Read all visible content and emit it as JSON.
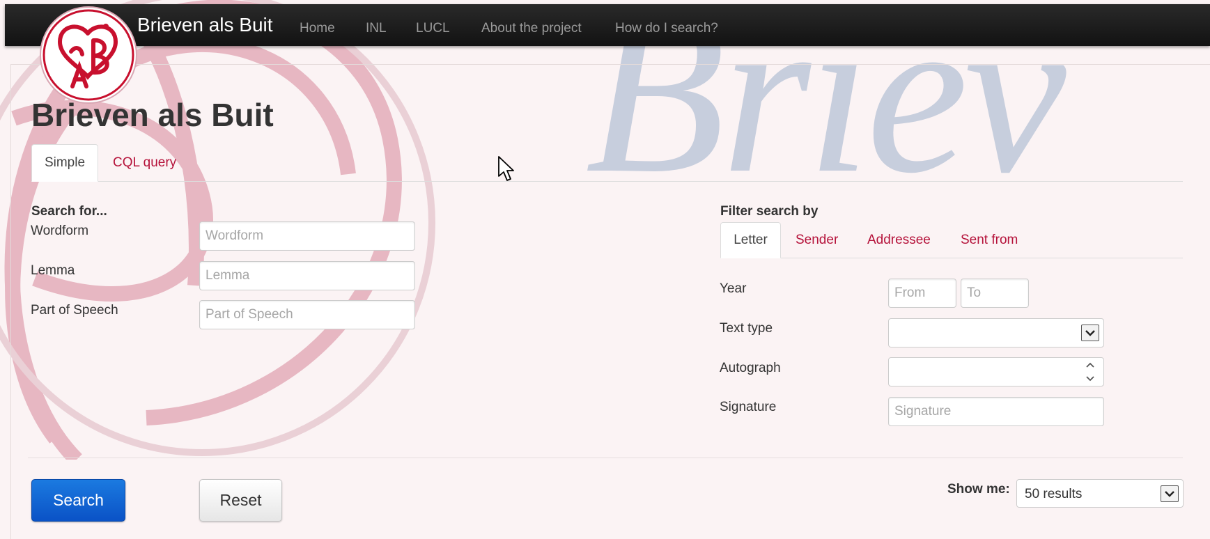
{
  "navbar": {
    "brand": "Brieven als Buit",
    "links": [
      "Home",
      "INL",
      "LUCL",
      "About the project",
      "How do I search?"
    ]
  },
  "watermark_text": "Briev",
  "page_title": "Brieven als Buit",
  "search_tabs": [
    "Simple",
    "CQL query"
  ],
  "search_for": {
    "heading": "Search for...",
    "fields": [
      {
        "label": "Wordform",
        "placeholder": "Wordform",
        "value": ""
      },
      {
        "label": "Lemma",
        "placeholder": "Lemma",
        "value": ""
      },
      {
        "label": "Part of Speech",
        "placeholder": "Part of Speech",
        "value": ""
      }
    ]
  },
  "filter": {
    "heading": "Filter search by",
    "tabs": [
      "Letter",
      "Sender",
      "Addressee",
      "Sent from"
    ],
    "year_label": "Year",
    "year_from_placeholder": "From",
    "year_to_placeholder": "To",
    "text_type_label": "Text type",
    "text_type_value": "",
    "autograph_label": "Autograph",
    "signature_label": "Signature",
    "signature_placeholder": "Signature"
  },
  "actions": {
    "search_label": "Search",
    "reset_label": "Reset",
    "show_me_label": "Show me:",
    "show_me_value": "50 results"
  },
  "colors": {
    "link": "#b5123a",
    "primary_button": "#0a52c6",
    "navbar": "#1a1a1a",
    "emblem": "#c8102e",
    "page_background": "#fbf3f4"
  },
  "icons": {
    "logo": "brieven-als-buit-emblem",
    "cursor": "mouse-pointer",
    "dropdown": "chevron-down",
    "spinner": "up-down-arrows"
  }
}
